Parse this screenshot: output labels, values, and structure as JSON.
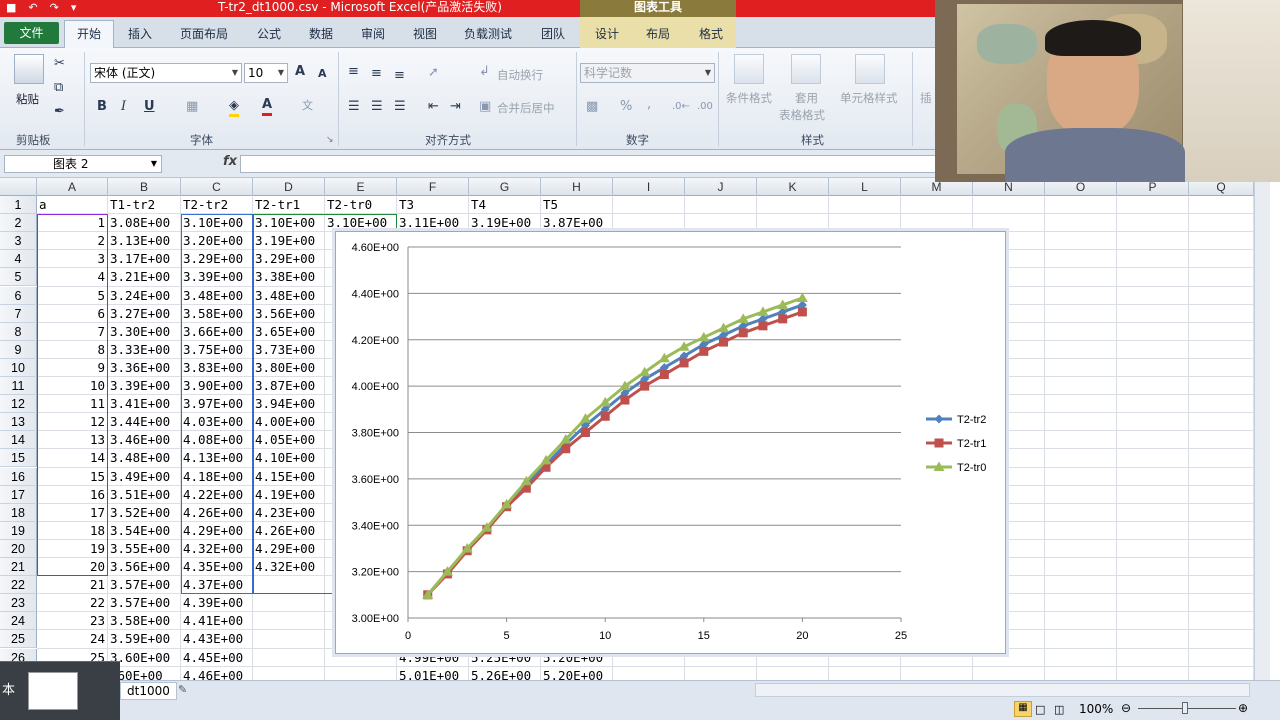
{
  "title_bar": {
    "title": "T-tr2_dt1000.csv  -  Microsoft Excel(产品激活失败)",
    "chart_tools": "图表工具",
    "qat": [
      "save-icon",
      "undo-icon",
      "redo-icon",
      "customize-icon"
    ]
  },
  "tabs": {
    "file": "文件",
    "home": "开始",
    "insert": "插入",
    "page_layout": "页面布局",
    "formulas": "公式",
    "data": "数据",
    "review": "审阅",
    "view": "视图",
    "load_test": "负载测试",
    "team": "团队",
    "design": "设计",
    "layout": "布局",
    "format": "格式"
  },
  "ribbon": {
    "clipboard": {
      "paste": "粘贴",
      "label": "剪贴板"
    },
    "font": {
      "name": "宋体 (正文)",
      "size": "10",
      "label": "字体",
      "bold": "B",
      "italic": "I",
      "underline": "U",
      "grow": "A",
      "shrink": "A"
    },
    "alignment": {
      "wrap": "自动换行",
      "merge": "合并后居中",
      "label": "对齐方式"
    },
    "number": {
      "format": "科学记数",
      "label": "数字",
      "percent": "%",
      "comma": ","
    },
    "styles": {
      "conditional": "条件格式",
      "table": "套用",
      "table2": "表格格式",
      "cell_styles": "单元格样式",
      "label": "样式"
    },
    "cells": {
      "insert": "插"
    }
  },
  "formula_bar": {
    "name_box": "图表 2",
    "fx": "fx",
    "value": ""
  },
  "sheet": {
    "columns": [
      "A",
      "B",
      "C",
      "D",
      "E",
      "F",
      "G",
      "H",
      "I",
      "J",
      "K",
      "L",
      "M",
      "N",
      "O",
      "P",
      "Q"
    ],
    "rows": [
      "1",
      "2",
      "3",
      "4",
      "5",
      "6",
      "7",
      "8",
      "9",
      "10",
      "11",
      "12",
      "13",
      "14",
      "15",
      "16",
      "17",
      "18",
      "19",
      "20",
      "21",
      "22",
      "23",
      "24",
      "25",
      "26",
      "27"
    ],
    "header_row": [
      "a",
      "T1-tr2",
      "T2-tr2",
      "T2-tr1",
      "T2-tr0",
      "T3",
      "T4",
      "T5"
    ],
    "col_a": [
      "1",
      "2",
      "3",
      "4",
      "5",
      "6",
      "7",
      "8",
      "9",
      "10",
      "11",
      "12",
      "13",
      "14",
      "15",
      "16",
      "17",
      "18",
      "19",
      "20",
      "21",
      "22",
      "23",
      "24",
      "25",
      ""
    ],
    "col_b": [
      "3.08E+00",
      "3.13E+00",
      "3.17E+00",
      "3.21E+00",
      "3.24E+00",
      "3.27E+00",
      "3.30E+00",
      "3.33E+00",
      "3.36E+00",
      "3.39E+00",
      "3.41E+00",
      "3.44E+00",
      "3.46E+00",
      "3.48E+00",
      "3.49E+00",
      "3.51E+00",
      "3.52E+00",
      "3.54E+00",
      "3.55E+00",
      "3.56E+00",
      "3.57E+00",
      "3.57E+00",
      "3.58E+00",
      "3.59E+00",
      "3.60E+00",
      ".60E+00"
    ],
    "col_c": [
      "3.10E+00",
      "3.20E+00",
      "3.29E+00",
      "3.39E+00",
      "3.48E+00",
      "3.58E+00",
      "3.66E+00",
      "3.75E+00",
      "3.83E+00",
      "3.90E+00",
      "3.97E+00",
      "4.03E+00",
      "4.08E+00",
      "4.13E+00",
      "4.18E+00",
      "4.22E+00",
      "4.26E+00",
      "4.29E+00",
      "4.32E+00",
      "4.35E+00",
      "4.37E+00",
      "4.39E+00",
      "4.41E+00",
      "4.43E+00",
      "4.45E+00",
      "4.46E+00"
    ],
    "col_d": [
      "3.10E+00",
      "3.19E+00",
      "3.29E+00",
      "3.38E+00",
      "3.48E+00",
      "3.56E+00",
      "3.65E+00",
      "3.73E+00",
      "3.80E+00",
      "3.87E+00",
      "3.94E+00",
      "4.00E+00",
      "4.05E+00",
      "4.10E+00",
      "4.15E+00",
      "4.19E+00",
      "4.23E+00",
      "4.26E+00",
      "4.29E+00",
      "4.32E+00"
    ],
    "col_e_partial": [
      "3.10E+00"
    ],
    "row2_rest": [
      "3.11E+00",
      "3.19E+00",
      "3.87E+00"
    ],
    "row26_rest": [
      "4.99E+00",
      "5.25E+00",
      "5.20E+00"
    ],
    "row27_rest": [
      "5.01E+00",
      "5.26E+00",
      "5.20E+00"
    ]
  },
  "chart_data": {
    "type": "line",
    "x": [
      1,
      2,
      3,
      4,
      5,
      6,
      7,
      8,
      9,
      10,
      11,
      12,
      13,
      14,
      15,
      16,
      17,
      18,
      19,
      20
    ],
    "series": [
      {
        "name": "T2-tr2",
        "color": "#4f81bd",
        "marker": "diamond",
        "values": [
          3.1,
          3.2,
          3.29,
          3.39,
          3.48,
          3.58,
          3.66,
          3.75,
          3.83,
          3.9,
          3.97,
          4.03,
          4.08,
          4.13,
          4.18,
          4.22,
          4.26,
          4.29,
          4.32,
          4.35
        ]
      },
      {
        "name": "T2-tr1",
        "color": "#c0504d",
        "marker": "square",
        "values": [
          3.1,
          3.19,
          3.29,
          3.38,
          3.48,
          3.56,
          3.65,
          3.73,
          3.8,
          3.87,
          3.94,
          4.0,
          4.05,
          4.1,
          4.15,
          4.19,
          4.23,
          4.26,
          4.29,
          4.32
        ]
      },
      {
        "name": "T2-tr0",
        "color": "#9bbb59",
        "marker": "triangle",
        "values": [
          3.1,
          3.2,
          3.3,
          3.39,
          3.49,
          3.59,
          3.68,
          3.77,
          3.86,
          3.93,
          4.0,
          4.06,
          4.12,
          4.17,
          4.21,
          4.25,
          4.29,
          4.32,
          4.35,
          4.38
        ]
      }
    ],
    "xlim": [
      0,
      25
    ],
    "ylim": [
      3.0,
      4.6
    ],
    "xticks": [
      "0",
      "5",
      "10",
      "15",
      "20",
      "25"
    ],
    "yticks": [
      "3.00E+00",
      "3.20E+00",
      "3.40E+00",
      "3.60E+00",
      "3.80E+00",
      "4.00E+00",
      "4.20E+00",
      "4.40E+00",
      "4.60E+00"
    ],
    "grid": true,
    "legend": "right"
  },
  "status": {
    "sheet_tab": "dt1000",
    "zoom": "100%",
    "overlay_text": "本"
  }
}
